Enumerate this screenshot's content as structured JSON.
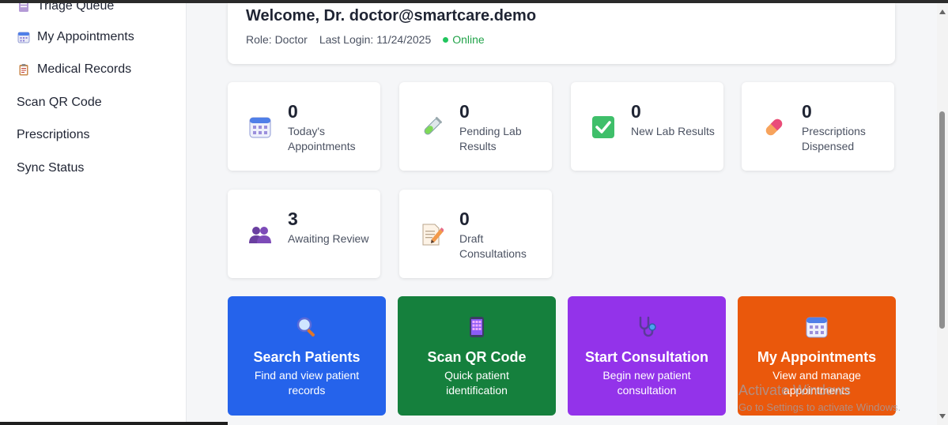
{
  "sidebar": {
    "items": [
      {
        "label": "Triage Queue",
        "icon": "triage-icon"
      },
      {
        "label": "My Appointments",
        "icon": "calendar-icon"
      },
      {
        "label": "Medical Records",
        "icon": "clipboard-icon"
      },
      {
        "label": "Scan QR Code"
      },
      {
        "label": "Prescriptions"
      },
      {
        "label": "Sync Status"
      }
    ]
  },
  "welcome": {
    "title": "Welcome, Dr. doctor@smartcare.demo",
    "role": "Role: Doctor",
    "last_login": "Last Login: 11/24/2025",
    "status": "Online",
    "status_color": "#22c55e"
  },
  "stats": [
    {
      "value": "0",
      "label": "Today's Appointments",
      "icon": "calendar-icon"
    },
    {
      "value": "0",
      "label": "Pending Lab Results",
      "icon": "test-tube-icon"
    },
    {
      "value": "0",
      "label": "New Lab Results",
      "icon": "check-mark-icon"
    },
    {
      "value": "0",
      "label": "Prescriptions Dispensed",
      "icon": "pill-icon"
    },
    {
      "value": "3",
      "label": "Awaiting Review",
      "icon": "people-icon"
    },
    {
      "value": "0",
      "label": "Draft Consultations",
      "icon": "memo-icon"
    }
  ],
  "actions": [
    {
      "title": "Search Patients",
      "subtitle": "Find and view patient records",
      "color": "#2563eb",
      "icon": "magnifier-icon"
    },
    {
      "title": "Scan QR Code",
      "subtitle": "Quick patient identification",
      "color": "#15803d",
      "icon": "qr-code-icon"
    },
    {
      "title": "Start Consultation",
      "subtitle": "Begin new patient consultation",
      "color": "#9333ea",
      "icon": "stethoscope-icon"
    },
    {
      "title": "My Appointments",
      "subtitle": "View and manage appointments",
      "color": "#ea580c",
      "icon": "calendar-icon"
    }
  ],
  "watermark": {
    "line1": "Activate Windows",
    "line2": "Go to Settings to activate Windows."
  }
}
